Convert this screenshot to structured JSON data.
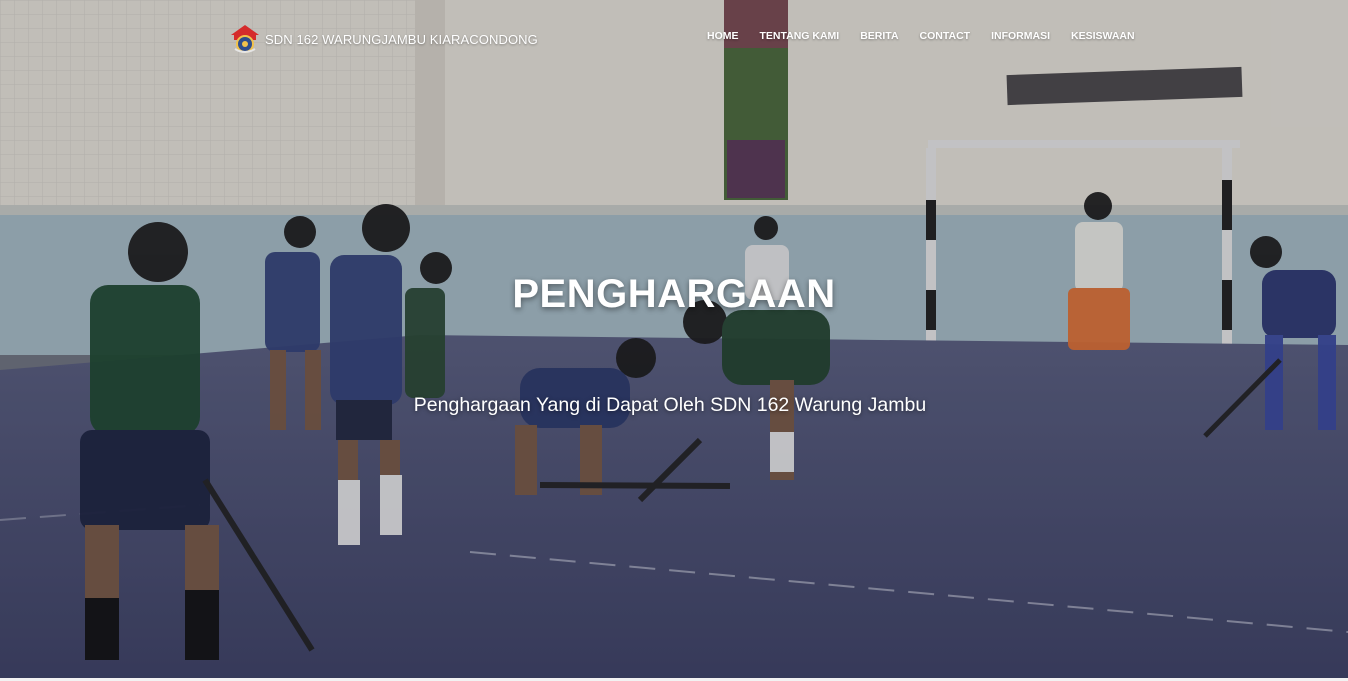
{
  "site": {
    "name": "SDN 162 WARUNGJAMBU KIARACONDONG",
    "logo_icon": "school-emblem-icon"
  },
  "nav": {
    "items": [
      {
        "label": "HOME"
      },
      {
        "label": "TENTANG KAMI"
      },
      {
        "label": "BERITA"
      },
      {
        "label": "CONTACT"
      },
      {
        "label": "INFORMASI"
      },
      {
        "label": "KESISWAAN"
      }
    ]
  },
  "hero": {
    "title": "PENGHARGAAN",
    "subtitle": "Penghargaan Yang di Dapat Oleh SDN 162 Warung Jambu",
    "background_image": "children-playing-hockey-indoor-court"
  },
  "colors": {
    "text": "#ffffff",
    "court": "#4d5378",
    "wall_upper": "#e6e2d8",
    "wall_lower": "#a9c0c8"
  }
}
